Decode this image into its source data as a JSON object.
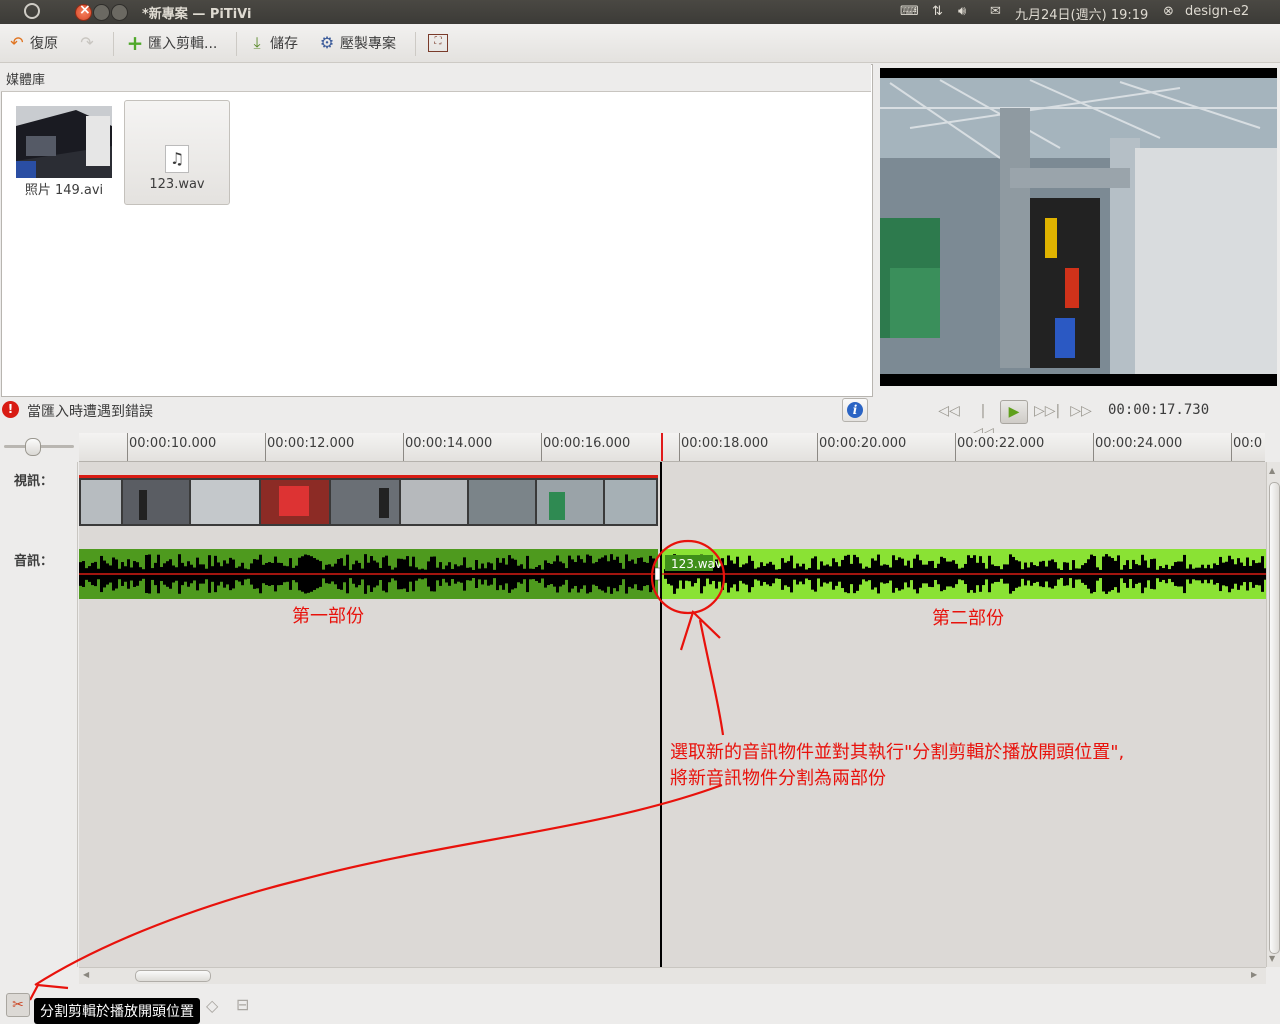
{
  "window": {
    "title": "*新專案 — PiTiVi"
  },
  "tray": {
    "datetime": "九月24日(週六) 19:19",
    "user": "design-e2"
  },
  "toolbar": {
    "undo": "復原",
    "import": "匯入剪輯...",
    "save": "儲存",
    "render": "壓製專案"
  },
  "media_library": {
    "title": "媒體庫",
    "items": [
      {
        "name": "照片 149.avi"
      },
      {
        "name": "123.wav"
      }
    ],
    "error": "當匯入時遭遇到錯誤"
  },
  "viewer": {
    "timecode": "00:00:17.730"
  },
  "ruler": {
    "ticks": [
      "00:00:10.000",
      "00:00:12.000",
      "00:00:14.000",
      "00:00:16.000",
      "00:00:18.000",
      "00:00:20.000",
      "00:00:22.000",
      "00:00:24.000",
      "00:0"
    ]
  },
  "tracks": {
    "video_label": "視訊：",
    "audio_label": "音訊：",
    "clip_label": "123.wav"
  },
  "annotations": {
    "part1": "第一部份",
    "part2": "第二部份",
    "note_line1": "選取新的音訊物件並對其執行\"分割剪輯於播放開頭位置\",",
    "note_line2": "將新音訊物件分割為兩部份"
  },
  "tooltip": "分割剪輯於播放開頭位置",
  "colors": {
    "annotation": "#e8120c",
    "audio_dark": "#4e9a1e",
    "audio_light": "#8ae234",
    "playhead": "#000000"
  }
}
